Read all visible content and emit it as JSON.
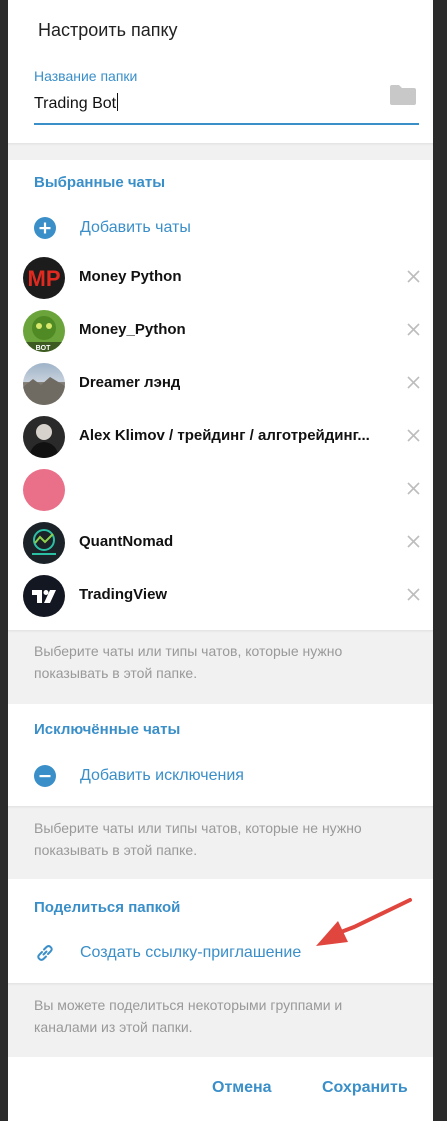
{
  "dialog": {
    "title": "Настроить папку",
    "folder_name_label": "Название папки",
    "folder_name_value": "Trading Bot"
  },
  "included": {
    "section_title": "Выбранные чаты",
    "add_label": "Добавить чаты",
    "chats": [
      {
        "name": "Money Python",
        "avatar": "mp-logo"
      },
      {
        "name": "Money_Python",
        "avatar": "green-creature-bot"
      },
      {
        "name": "Dreamer лэнд",
        "avatar": "landscape-photo"
      },
      {
        "name": "Alex Klimov / трейдинг / алготрейдинг...",
        "avatar": "person-photo"
      },
      {
        "name": "",
        "avatar": "pink-circle"
      },
      {
        "name": "QuantNomad",
        "avatar": "quantnomad-logo"
      },
      {
        "name": "TradingView",
        "avatar": "tradingview-logo"
      }
    ],
    "hint": "Выберите чаты или типы чатов, которые нужно показывать в этой папке."
  },
  "excluded": {
    "section_title": "Исключённые чаты",
    "add_label": "Добавить исключения",
    "hint": "Выберите чаты или типы чатов, которые не нужно показывать в этой папке."
  },
  "share": {
    "section_title": "Поделиться папкой",
    "link_label": "Создать ссылку-приглашение",
    "hint": "Вы можете поделиться некоторыми группами и каналами из этой папки."
  },
  "footer": {
    "cancel_label": "Отмена",
    "save_label": "Сохранить"
  },
  "colors": {
    "accent": "#3a8fc9",
    "annotation_arrow": "#e0463d"
  }
}
